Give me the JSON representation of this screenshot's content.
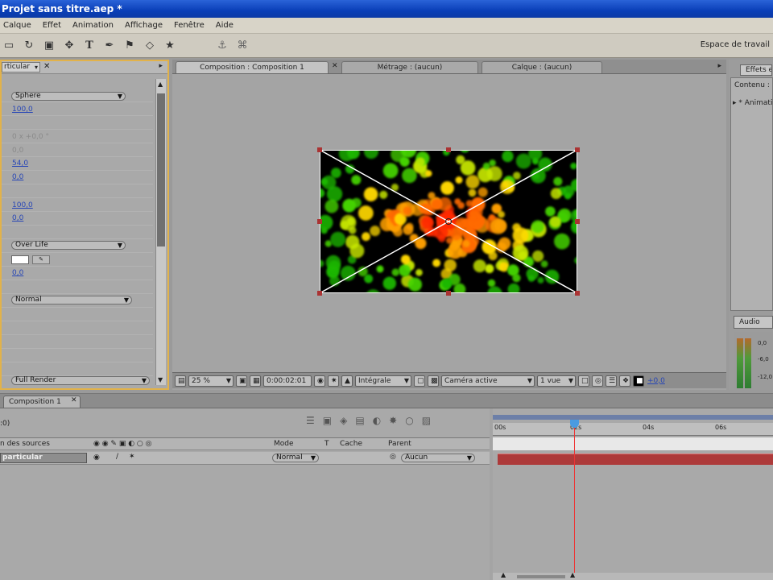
{
  "window": {
    "title": "Projet sans titre.aep *"
  },
  "menu": [
    "Calque",
    "Effet",
    "Animation",
    "Affichage",
    "Fenêtre",
    "Aide"
  ],
  "toolbar": {
    "icons": [
      "select-icon",
      "rotate-icon",
      "camera-icon",
      "pan-behind-icon",
      "text-icon",
      "pen-icon",
      "clone-stamp-icon",
      "eraser-icon",
      "puppet-pin-icon"
    ],
    "workspace_label": "Espace de travail"
  },
  "effects_panel": {
    "tab_label": "rticular",
    "rows": [
      {
        "type": "dropdown",
        "value": "Sphere"
      },
      {
        "type": "value",
        "value": "100,0"
      },
      {
        "type": "value",
        "value": "0 x +0,0 °",
        "dim": true
      },
      {
        "type": "value",
        "value": "0,0",
        "dim": true
      },
      {
        "type": "value",
        "value": "54,0"
      },
      {
        "type": "value",
        "value": "0,0"
      },
      {
        "type": "value",
        "value": "100,0"
      },
      {
        "type": "value",
        "value": "0,0"
      },
      {
        "type": "dropdown",
        "value": "Over Life"
      },
      {
        "type": "value",
        "value": "0,0"
      },
      {
        "type": "dropdown",
        "value": "Normal"
      },
      {
        "type": "dropdown",
        "value": "Full Render"
      }
    ]
  },
  "composition_panel": {
    "tabs": [
      {
        "label": "Composition : Composition 1",
        "active": true
      },
      {
        "label": "Métrage : (aucun)",
        "active": false
      },
      {
        "label": "Calque : (aucun)",
        "active": false
      }
    ],
    "footer": {
      "zoom": "25 %",
      "timecode": "0:00:02:01",
      "resolution": "Intégrale",
      "camera": "Caméra active",
      "views": "1 vue",
      "exposure": "+0,0"
    }
  },
  "right_panel": {
    "tab_label": "Effets et paramètres prédéfinis",
    "content_label": "Contenu :",
    "item_label": "* Animation",
    "audio_tab": "Audio",
    "audio_levels": [
      "0,0",
      "-6,0",
      "-12,0"
    ]
  },
  "timeline": {
    "tab_label": "Composition 1",
    "timecode_fragment": ":0)",
    "columns": {
      "source": "n des sources",
      "mode": "Mode",
      "t": "T",
      "trkmat": "Cache",
      "parent": "Parent"
    },
    "layer": {
      "name": "particular",
      "mode": "Normal",
      "parent": "Aucun"
    },
    "ruler_labels": [
      "00s",
      "02s",
      "04s",
      "06s"
    ],
    "cti_position_s": 2.0
  },
  "particles": {
    "colors": [
      "#ff2a00",
      "#ff6a00",
      "#ffa000",
      "#ffd800",
      "#c8e800",
      "#44d400",
      "#1fb800"
    ]
  }
}
